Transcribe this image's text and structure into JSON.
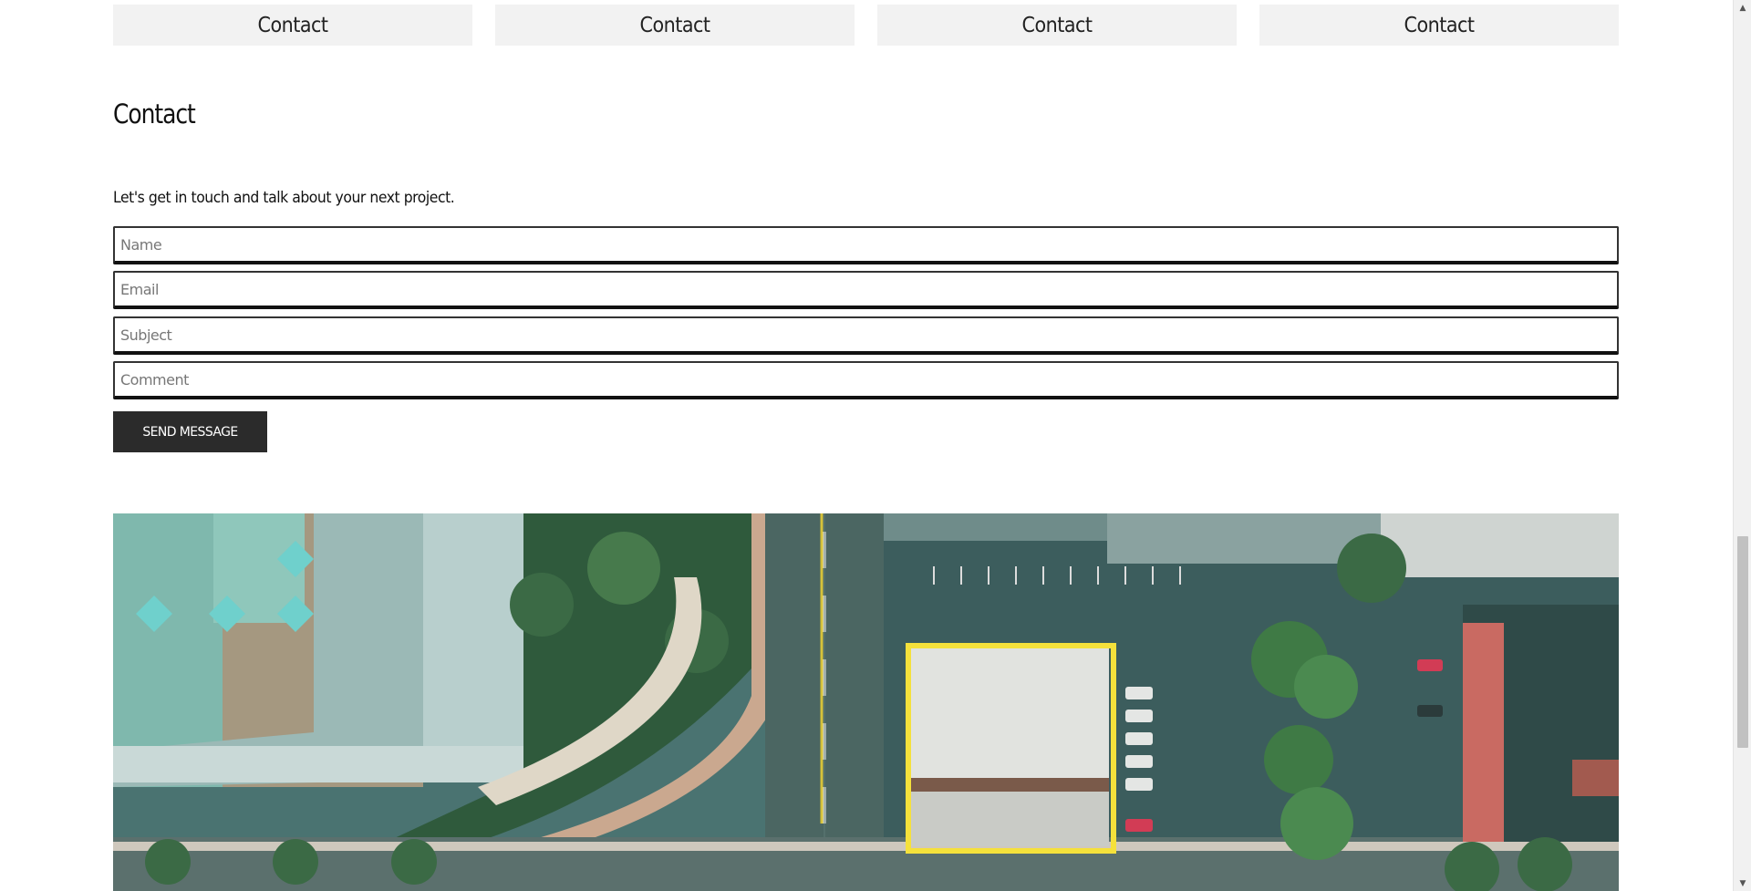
{
  "top_buttons": [
    {
      "label": "Contact"
    },
    {
      "label": "Contact"
    },
    {
      "label": "Contact"
    },
    {
      "label": "Contact"
    }
  ],
  "contact": {
    "title": "Contact",
    "intro": "Let's get in touch and talk about your next project.",
    "fields": {
      "name_placeholder": "Name",
      "email_placeholder": "Email",
      "subject_placeholder": "Subject",
      "comment_placeholder": "Comment"
    },
    "submit_label": "Send Message"
  },
  "colors": {
    "button_bg": "#f2f2f2",
    "submit_bg": "#2b2b2b",
    "highlight": "#f5e13b"
  },
  "icons": {
    "scroll_up": "▲",
    "scroll_down": "▼"
  }
}
